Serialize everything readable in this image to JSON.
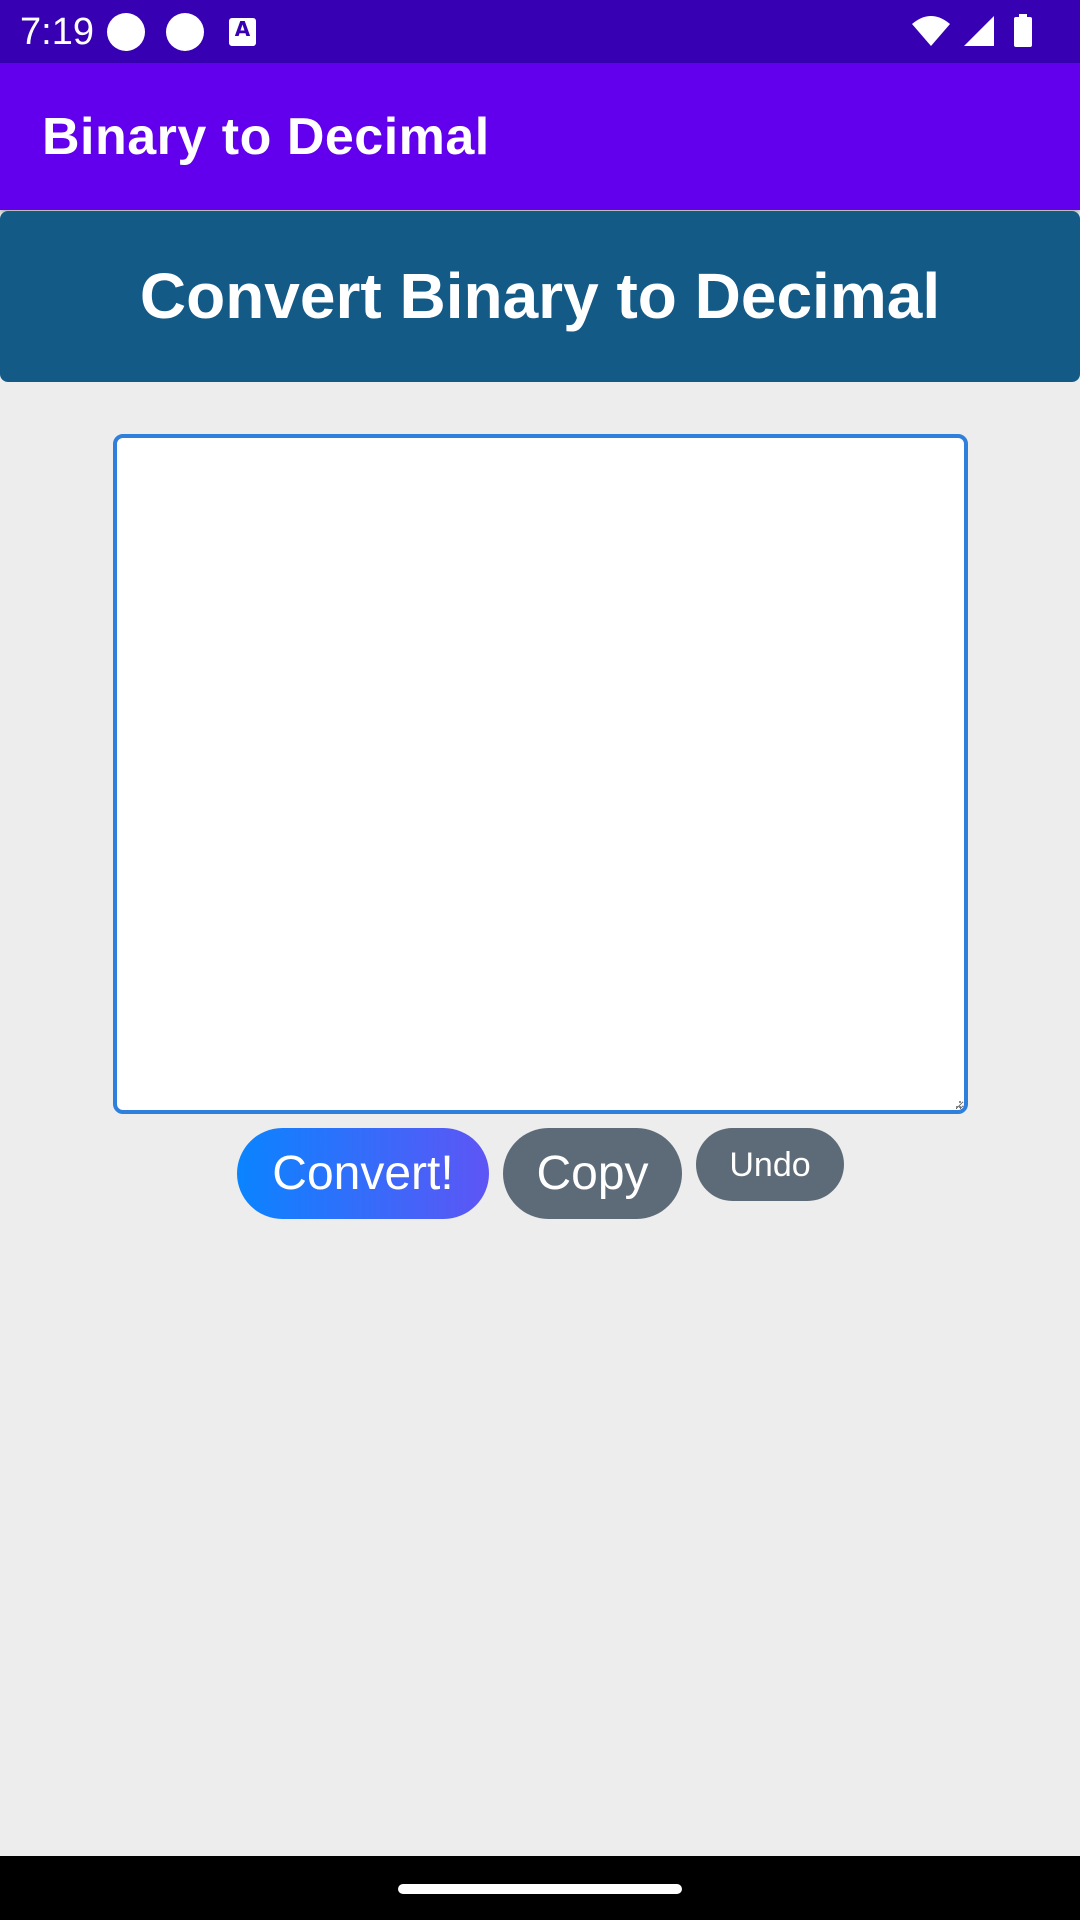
{
  "status_bar": {
    "time": "7:19",
    "icons": [
      "notification-dot-icon",
      "notification-dot-icon",
      "accessibility-a-icon",
      "wifi-icon",
      "signal-icon",
      "battery-icon"
    ]
  },
  "app_bar": {
    "title": "Binary to Decimal"
  },
  "banner": {
    "title": "Convert Binary to Decimal"
  },
  "input": {
    "value": "",
    "placeholder": ""
  },
  "buttons": {
    "convert_label": "Convert!",
    "copy_label": "Copy",
    "undo_label": "Undo"
  },
  "colors": {
    "status_bar": "#3700b3",
    "app_bar": "#6200ee",
    "banner": "#135a86",
    "input_border": "#2f7fdc",
    "convert_gradient_start": "#0a84ff",
    "convert_gradient_end": "#5e55f5",
    "secondary_button": "#5d6b78",
    "background": "#ededed"
  }
}
